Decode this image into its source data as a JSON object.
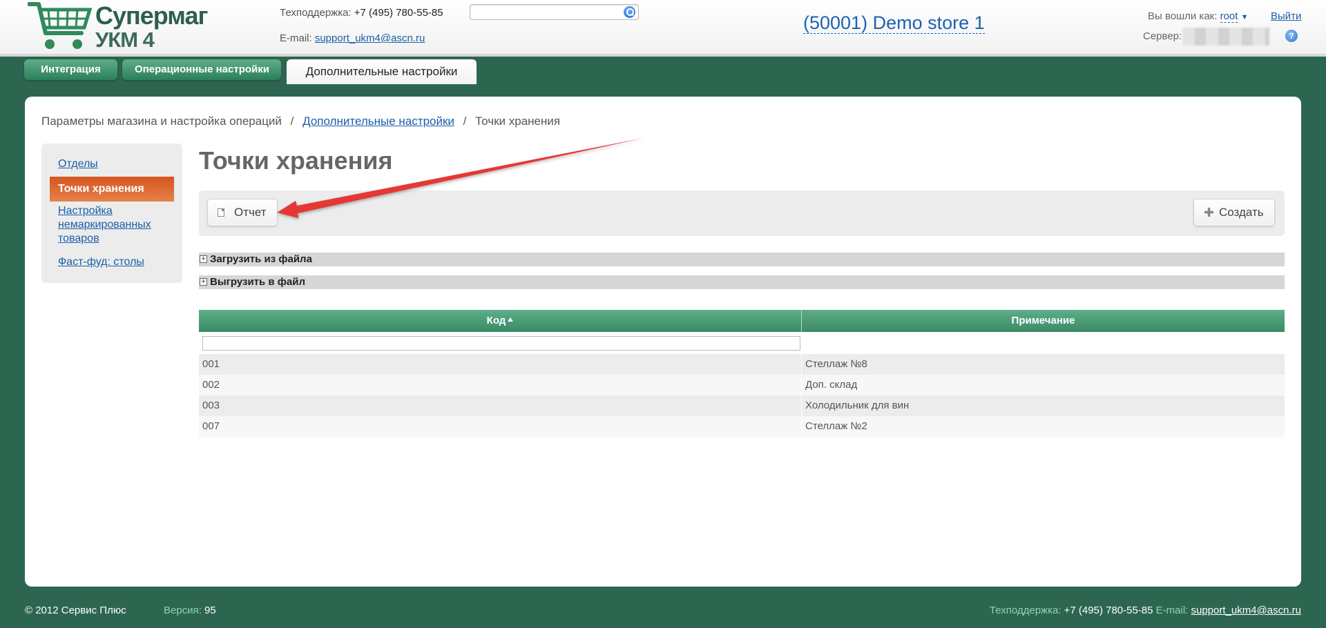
{
  "header": {
    "logo": {
      "line1": "Супермаг",
      "line2": "УКМ 4"
    },
    "support_label": "Техподдержка:",
    "support_phone": "+7 (495) 780-55-85",
    "email_label": "E-mail:",
    "email": "support_ukm4@ascn.ru",
    "search_placeholder": "",
    "store_title": "(50001) Demo store 1",
    "login_label": "Вы вошли как:",
    "login_user": "root",
    "logout": "Выйти",
    "server_label": "Сервер:",
    "help": "?"
  },
  "tabs": [
    {
      "label": "Интеграция"
    },
    {
      "label": "Операционные настройки"
    },
    {
      "label": "Дополнительные настройки"
    }
  ],
  "breadcrumb": {
    "item1": "Параметры магазина и настройка операций",
    "item2": "Дополнительные настройки",
    "item3": "Точки хранения",
    "sep": "/"
  },
  "sidebar": {
    "items": [
      {
        "label": "Отделы"
      },
      {
        "label": "Точки хранения"
      },
      {
        "label": "Настройка немаркированных товаров"
      },
      {
        "label": "Фаст-фуд: столы"
      }
    ]
  },
  "page": {
    "title": "Точки хранения",
    "report_button": "Отчет",
    "create_button": "Создать",
    "upload_section": "Загрузить из файла",
    "export_section": "Выгрузить в файл"
  },
  "table": {
    "columns": [
      "Код",
      "Примечание"
    ],
    "rows": [
      {
        "code": "001",
        "note": "Стеллаж №8"
      },
      {
        "code": "002",
        "note": "Доп. склад"
      },
      {
        "code": "003",
        "note": "Холодильник для вин"
      },
      {
        "code": "007",
        "note": "Стеллаж №2"
      }
    ]
  },
  "footer": {
    "copyright": "© 2012 Сервис Плюс",
    "version_label": "Версия:",
    "version": "95",
    "support_label": "Техподдержка:",
    "support_phone": "+7 (495) 780-55-85",
    "email_label": "E-mail:",
    "email": "support_ukm4@ascn.ru"
  },
  "colors": {
    "background": "#2c6650",
    "accent_green": "#3a8a66",
    "active_orange": "#d4551f",
    "link_blue": "#1a5fa8",
    "annotation_red": "#e53935"
  }
}
